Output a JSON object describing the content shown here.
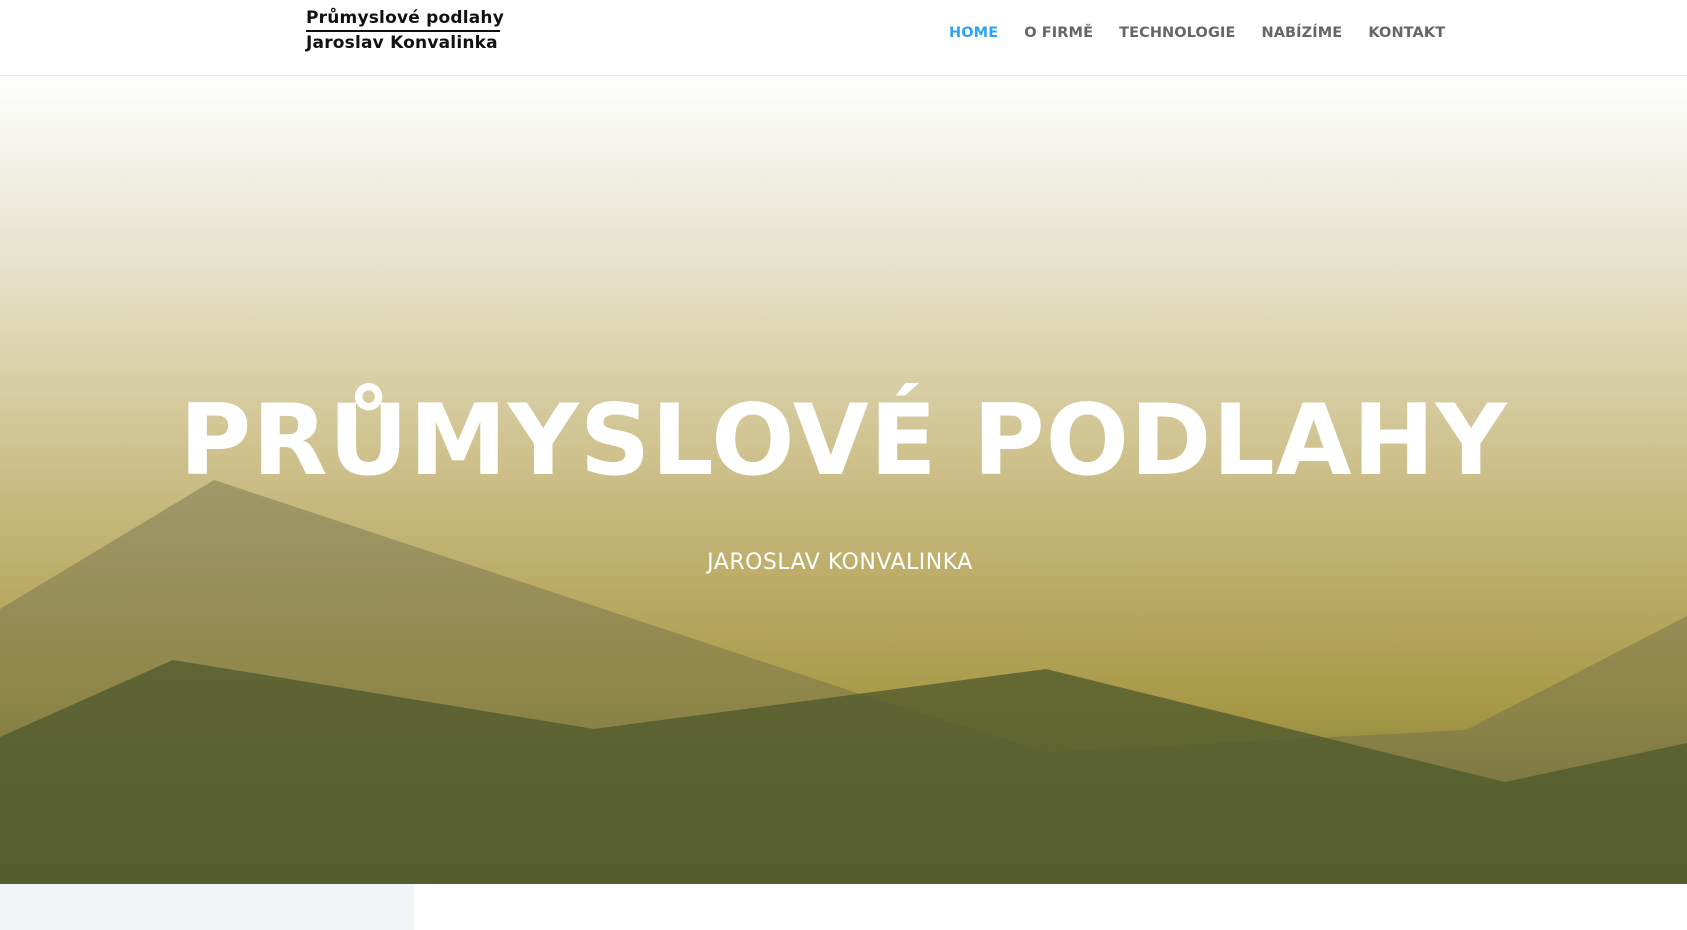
{
  "logo": {
    "line1": "Průmyslové podlahy",
    "line2": "Jaroslav Konvalinka"
  },
  "nav": {
    "items": [
      {
        "label": "HOME",
        "active": true
      },
      {
        "label": "O FIRMĚ",
        "active": false
      },
      {
        "label": "TECHNOLOGIE",
        "active": false
      },
      {
        "label": "NABÍZÍME",
        "active": false
      },
      {
        "label": "KONTAKT",
        "active": false
      }
    ]
  },
  "hero": {
    "title": "PRŮMYSLOVÉ PODLAHY",
    "subtitle": "JAROSLAV KONVALINKA"
  },
  "colors": {
    "nav_active": "#2ea3f2",
    "nav_text": "#666666",
    "hero_top": "#ffffff",
    "hero_mid": "#cbbd85",
    "hero_bottom": "#6f6f3a",
    "mountain_back": "#8a8a5e",
    "mountain_front": "#55602f",
    "bottom_left_panel": "#f1f4f7"
  }
}
